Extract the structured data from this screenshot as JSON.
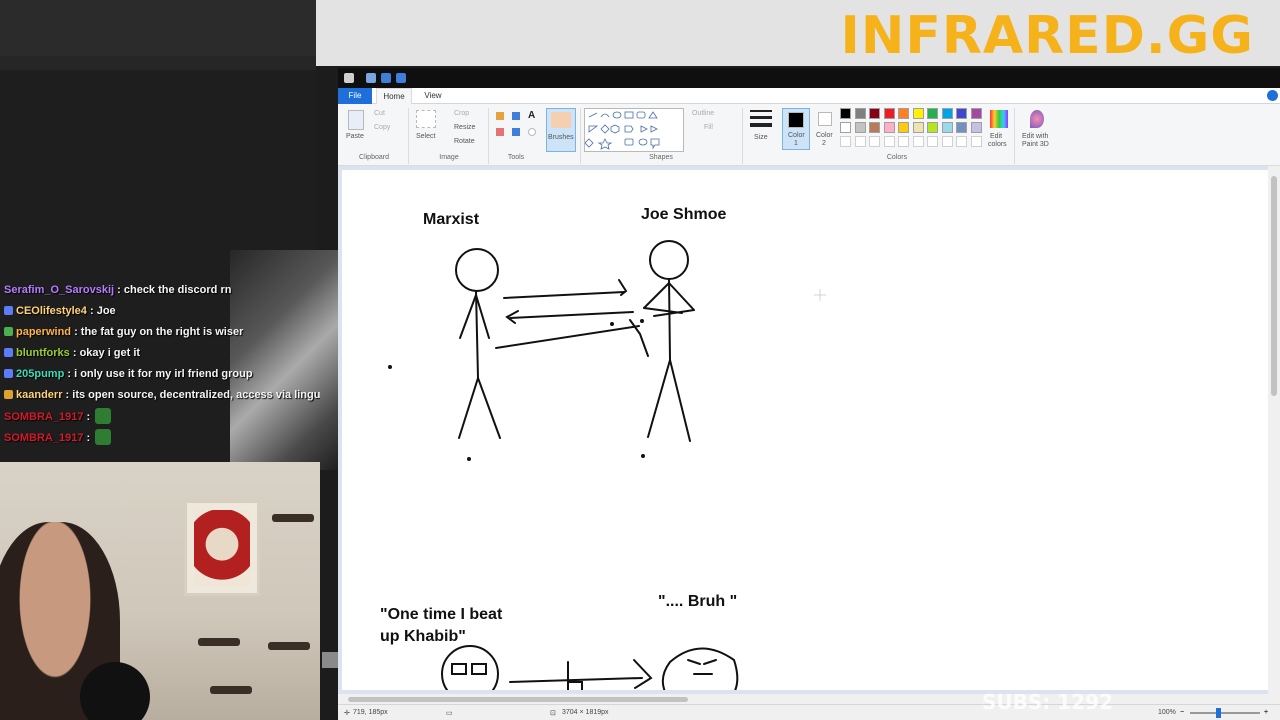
{
  "brand": {
    "name": "INFRARED.GG"
  },
  "chat": {
    "messages": [
      {
        "user": "Serafim_O_Sarovskij",
        "color": "#b57cff",
        "text": "check the discord rn",
        "badge_color": ""
      },
      {
        "user": "CEOlifestyle4",
        "color": "#ffd27a",
        "text": "Joe",
        "badge_color": "#5c7cfa"
      },
      {
        "user": "paperwind",
        "color": "#ffb347",
        "text": "the fat guy on the right is wiser",
        "badge_color": "#4caf50"
      },
      {
        "user": "bluntforks",
        "color": "#9acd32",
        "text": "okay i get it",
        "badge_color": "#5c7cfa"
      },
      {
        "user": "205pump",
        "color": "#3fd9b4",
        "text": "i only use it for my irl friend group",
        "badge_color": "#5c7cfa"
      },
      {
        "user": "kaanderr",
        "color": "#ffd27a",
        "text": "its open source, decentralized, access via lingual",
        "badge_color": "#e0a030"
      },
      {
        "user": "SOMBRA_1917",
        "color": "#d11a2a",
        "text": "",
        "badge_color": "",
        "emote": "pepe-emote"
      },
      {
        "user": "SOMBRA_1917",
        "color": "#d11a2a",
        "text": "",
        "badge_color": "",
        "emote": "pepe-emote"
      }
    ]
  },
  "paint": {
    "menu": {
      "file": "File",
      "home": "Home",
      "view": "View"
    },
    "ribbon": {
      "clipboard": {
        "paste": "Paste",
        "cut": "Cut",
        "copy": "Copy",
        "label": "Clipboard"
      },
      "image": {
        "select": "Select",
        "crop": "Crop",
        "resize": "Resize",
        "rotate": "Rotate",
        "label": "Image"
      },
      "tools": {
        "label": "Tools"
      },
      "brushes": {
        "label": "Brushes"
      },
      "shapes": {
        "outline": "Outline",
        "fill": "Fill",
        "label": "Shapes"
      },
      "size": {
        "label": "Size"
      },
      "color1": {
        "label": "Color",
        "num": "1",
        "value": "#000000"
      },
      "color2": {
        "label": "Color",
        "num": "2",
        "value": "#ffffff"
      },
      "colors": {
        "label": "Colors",
        "row1": [
          "#000000",
          "#7f7f7f",
          "#880015",
          "#ed1c24",
          "#ff7f27",
          "#fff200",
          "#22b14c",
          "#00a2e8",
          "#3f48cc",
          "#a349a4"
        ],
        "row2": [
          "#ffffff",
          "#c3c3c3",
          "#b97a57",
          "#ffaec9",
          "#ffc90e",
          "#efe4b0",
          "#b5e61d",
          "#99d9ea",
          "#7092be",
          "#c8bfe7"
        ]
      },
      "edit_colors": {
        "line1": "Edit",
        "line2": "colors"
      },
      "paint3d": {
        "line1": "Edit with",
        "line2": "Paint 3D"
      }
    },
    "canvas": {
      "label_marxist": "Marxist",
      "label_joe": "Joe Shmoe",
      "quote_left_1": "\"One time I beat",
      "quote_left_2": "up Khabib\"",
      "quote_right": "\".... Bruh \""
    },
    "status": {
      "cursor_pos": "719, 185px",
      "canvas_size": "3704 × 1819px",
      "zoom": "100%"
    }
  },
  "overlay": {
    "subs": "SUBS: 1292"
  }
}
